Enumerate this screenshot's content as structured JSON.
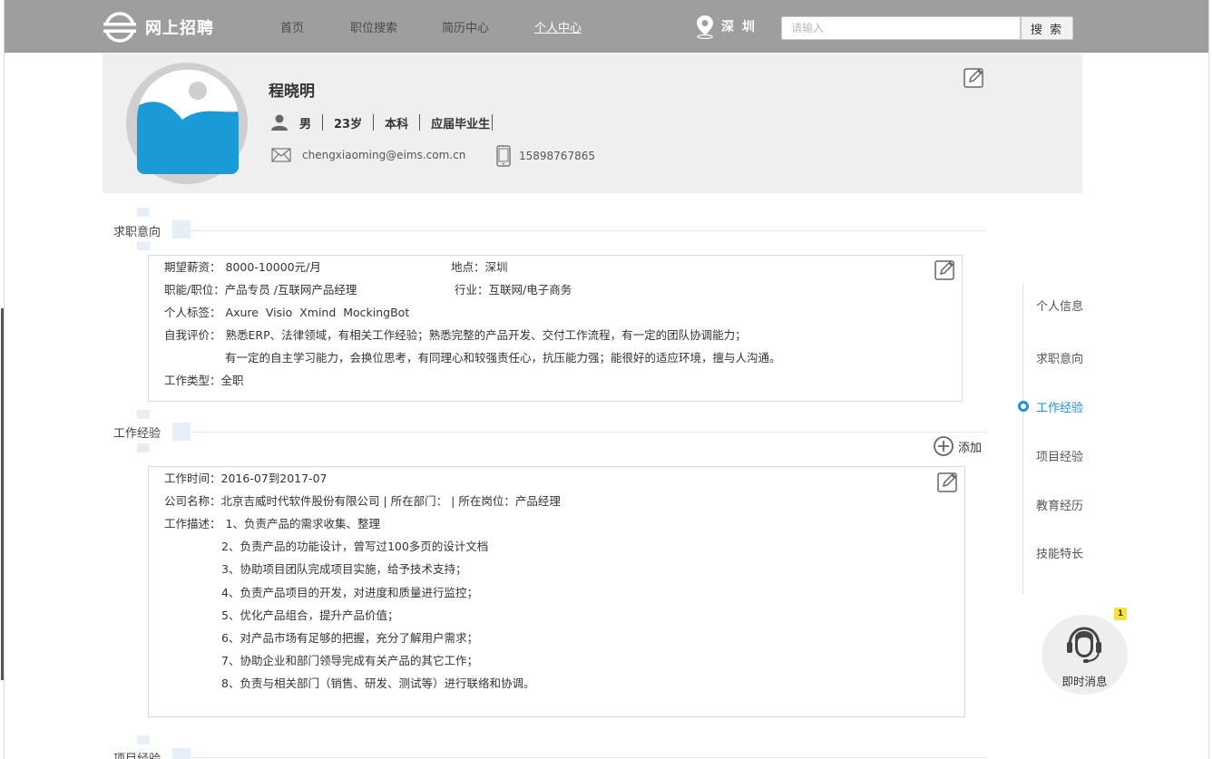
{
  "header": {
    "site_name": "网上招聘",
    "nav": [
      "首页",
      "职位搜索",
      "简历中心",
      "个人中心"
    ],
    "active_nav": "个人中心",
    "city": "深 圳",
    "search_placeholder": "请输入",
    "search_button": "搜 索"
  },
  "profile": {
    "name": "程晓明",
    "gender": "男",
    "age": "23岁",
    "education": "本科",
    "status": "应届毕业生",
    "email": "chengxiaoming@eims.com.cn",
    "phone": "15898767865"
  },
  "intent": {
    "title": "求职意向",
    "salary_label": "期望薪资：",
    "salary": "8000-10000元/月",
    "location_label": "地点：",
    "location": "深圳",
    "position_label": "职能/职位：",
    "position": "产品专员 /互联网产品经理",
    "industry_label": "行业：",
    "industry": "互联网/电子商务",
    "tags_label": "个人标签：",
    "tags": "Axure  Visio  Xmind  MockingBot",
    "self_eval_label": "自我评价：",
    "self_eval_line1": "熟悉ERP、法律领域，有相关工作经验；熟悉完整的产品开发、交付工作流程，有一定的团队协调能力；",
    "self_eval_line2": "有一定的自主学习能力，会换位思考，有同理心和较强责任心，抗压能力强；能很好的适应环境，擅与人沟通。",
    "job_type_label": "工作类型：",
    "job_type": "全职"
  },
  "work": {
    "title": "工作经验",
    "add_label": "添加",
    "time_label": "工作时间：",
    "time": "2016-07到2017-07",
    "company_line": "公司名称：北京吉威时代软件股份有限公司 | 所在部门： | 所在岗位：产品经理",
    "desc_label": "工作描述：",
    "desc": [
      "1、负责产品的需求收集、整理",
      "2、负责产品的功能设计，曾写过100多页的设计文档",
      "3、协助项目团队完成项目实施，给予技术支持；",
      "4、负责产品项目的开发，对进度和质量进行监控；",
      "5、优化产品组合，提升产品价值；",
      "6、对产品市场有足够的把握，充分了解用户需求；",
      "7、协助企业和部门领导完成有关产品的其它工作；",
      "8、负责与相关部门（销售、研发、测试等）进行联络和协调。"
    ]
  },
  "project": {
    "title": "项目经验"
  },
  "side_nav": {
    "items": [
      "个人信息",
      "求职意向",
      "工作经验",
      "项目经验",
      "教育经历",
      "技能特长"
    ],
    "active": "工作经验"
  },
  "chat": {
    "label": "即时消息",
    "badge": "1"
  },
  "colors": {
    "header_bg": "#9e9e9e",
    "profile_bg": "#efefef",
    "accent": "#1e90e6",
    "avatar_blue": "#1a9ad6"
  }
}
